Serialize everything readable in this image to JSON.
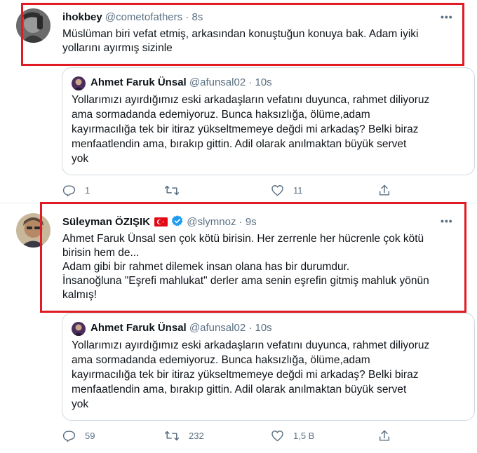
{
  "tweets": [
    {
      "name": "ihokbey",
      "handle": "@cometofathers",
      "separator": "·",
      "time": "8s",
      "more": "•••",
      "lines": [
        "Müslüman biri vefat etmiş, arkasından konuştuğun konuya bak. Adam iyiki",
        "yollarını ayırmış sizinle"
      ],
      "quote": {
        "name": "Ahmet Faruk Ünsal",
        "handle": "@afunsal02",
        "separator": "·",
        "time": "10s",
        "lines": [
          "Yollarımızı ayırdığımız eski arkadaşların vefatını duyunca, rahmet diliyoruz",
          "ama sormadanda edemiyoruz. Bunca haksızlığa, ölüme,adam",
          "kayırmacılığa tek bir itiraz yükseltmemeye değdi mi arkadaş? Belki biraz",
          "menfaatlendin ama, bırakıp gittin. Adil olarak anılmaktan büyük servet",
          "yok"
        ]
      },
      "actions": {
        "reply": "1",
        "retweet": "",
        "like": "11"
      }
    },
    {
      "name": "Süleyman ÖZIŞIK",
      "handle": "@slymnoz",
      "separator": "·",
      "time": "9s",
      "more": "•••",
      "lines": [
        "Ahmet Faruk Ünsal sen çok kötü birisin. Her zerrenle her hücrenle çok kötü",
        "birisin hem de...",
        "Adam gibi bir rahmet dilemek insan olana has bir durumdur.",
        "İnsanoğluna \"Eşrefi mahlukat\" derler ama senin eşrefin gitmiş mahluk yönün",
        "kalmış!"
      ],
      "quote": {
        "name": "Ahmet Faruk Ünsal",
        "handle": "@afunsal02",
        "separator": "·",
        "time": "10s",
        "lines": [
          "Yollarımızı ayırdığımız eski arkadaşların vefatını duyunca, rahmet diliyoruz",
          "ama sormadanda edemiyoruz. Bunca haksızlığa, ölüme,adam",
          "kayırmacılığa tek bir itiraz yükseltmemeye değdi mi arkadaş? Belki biraz",
          "menfaatlendin ama, bırakıp gittin. Adil olarak anılmaktan büyük servet",
          "yok"
        ]
      },
      "actions": {
        "reply": "59",
        "retweet": "232",
        "like": "1,5 B"
      }
    }
  ],
  "icons": {
    "reply": "reply-icon",
    "retweet": "retweet-icon",
    "like": "heart-icon",
    "share": "share-icon",
    "verified": "verified-badge-icon",
    "flag": "turkey-flag-icon"
  },
  "colors": {
    "highlight": "#e01b24",
    "secondary_text": "#5b7083",
    "border": "#cfd9de",
    "verified": "#1d9bf0"
  }
}
